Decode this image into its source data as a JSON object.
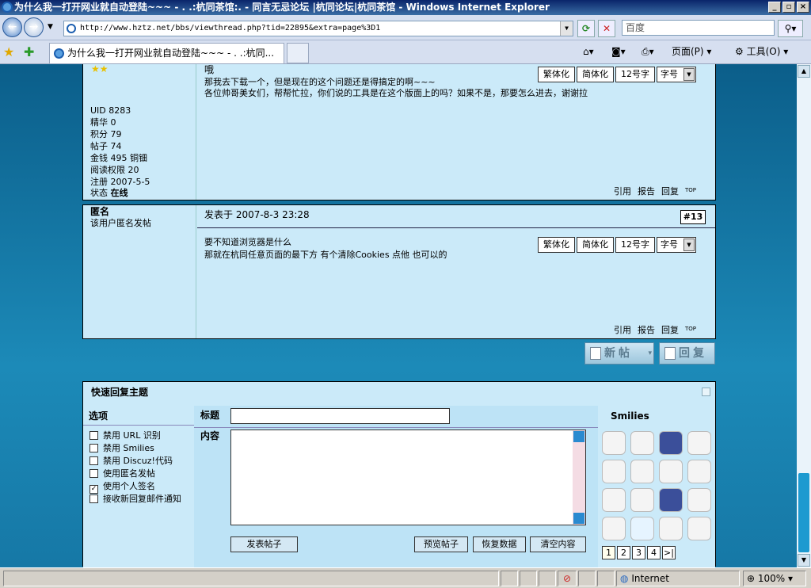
{
  "window": {
    "title": "为什么我一打开网业就自动登陆~~~ - . .:杭同茶馆:. - 同言无忌论坛 |杭同论坛|杭同茶馆 - Windows Internet Explorer"
  },
  "nav": {
    "url": "http://www.hztz.net/bbs/viewthread.php?tid=22895&extra=page%3D1",
    "search_placeholder": "百度"
  },
  "tab": {
    "label": "为什么我一打开网业就自动登陆~~~ - . .:杭同..."
  },
  "commands": {
    "page": "页面(P)",
    "tools": "工具(O)"
  },
  "post1": {
    "body_line1": "哦",
    "body_line2": "那我去下载一个，但是现在的这个问题还是得搞定的啊~~~",
    "body_line3": "各位帅哥美女们，帮帮忙拉，你们说的工具是在这个版面上的吗？如果不是，那要怎么进去，谢谢拉",
    "uid": "UID 8283",
    "stats": [
      {
        "label": "精华",
        "value": "0"
      },
      {
        "label": "积分",
        "value": "79"
      },
      {
        "label": "帖子",
        "value": "74"
      },
      {
        "label": "金钱",
        "value": "495 铜钿"
      },
      {
        "label": "阅读权限",
        "value": "20"
      },
      {
        "label": "注册",
        "value": "2007-5-5"
      },
      {
        "label": "状态",
        "value": "在线"
      }
    ]
  },
  "post2": {
    "author": "匿名",
    "author_note": "该用户匿名发帖",
    "date": "发表于  2007-8-3 23:28",
    "floor": "#13",
    "body_line1": "要不知道浏览器是什么",
    "body_line2": "那就在杭同任意页面的最下方  有个清除Cookies 点他  也可以的"
  },
  "post_tools": {
    "traditional": "繁体化",
    "simplified": "简体化",
    "size12": "12号字",
    "font_size": "字号"
  },
  "post_actions": {
    "quote": "引用",
    "report": "报告",
    "reply": "回复",
    "top": "TOP"
  },
  "big_buttons": {
    "new_post": "新帖",
    "reply": "回复"
  },
  "quick_reply": {
    "title": "快速回复主题",
    "options_label": "选项",
    "subject_label": "标题",
    "content_label": "内容",
    "smilies_label": "Smilies",
    "options": [
      {
        "label": "禁用 URL 识别",
        "checked": false
      },
      {
        "label": "禁用 Smilies",
        "checked": false
      },
      {
        "label": "禁用 Discuz!代码",
        "checked": false
      },
      {
        "label": "使用匿名发帖",
        "checked": false
      },
      {
        "label": "使用个人签名",
        "checked": true
      },
      {
        "label": "接收新回复邮件通知",
        "checked": false
      }
    ],
    "submit": "发表帖子",
    "preview": "预览帖子",
    "restore": "恢复数据",
    "clear": "清空内容",
    "pages": [
      "1",
      "2",
      "3",
      "4",
      ">|"
    ]
  },
  "status": {
    "zone": "Internet",
    "zoom": "100%"
  }
}
